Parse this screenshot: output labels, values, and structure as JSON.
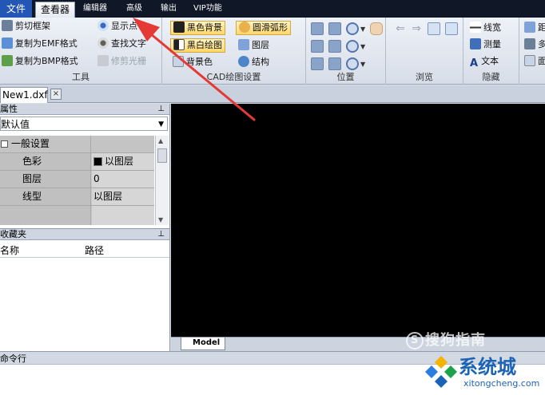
{
  "menubar": {
    "items": [
      "文件",
      "查看器",
      "编辑器",
      "高级",
      "输出",
      "VIP功能"
    ],
    "active": "查看器"
  },
  "ribbon": {
    "tools_group": {
      "label": "工具",
      "buttons": [
        "剪切框架",
        "复制为EMF格式",
        "复制为BMP格式",
        "显示点",
        "查找文字",
        "修剪光栅"
      ]
    },
    "cad_group": {
      "label": "CAD绘图设置",
      "buttons": [
        "黑色背景",
        "圆滑弧形",
        "黑白绘图",
        "图层",
        "背景色",
        "结构"
      ]
    },
    "position_group": {
      "label": "位置"
    },
    "browse_group": {
      "label": "浏览"
    },
    "hide_group": {
      "label": "隐藏",
      "buttons": [
        "线宽",
        "测量",
        "文本"
      ]
    },
    "extra_group": {
      "buttons": [
        "距",
        "多",
        "面"
      ]
    },
    "icons": [
      "cut-icon",
      "emf-icon",
      "bmp-icon",
      "show-point-icon",
      "find-text-icon",
      "crop-raster-icon",
      "zoom-icon",
      "hand-icon",
      "back-arrow-icon",
      "forward-arrow-icon",
      "linewidth-icon",
      "measure-icon"
    ]
  },
  "doc_tab": {
    "name": "New1.dxf",
    "close": "×"
  },
  "properties": {
    "title": "属性",
    "pin": "⊥",
    "combo_value": "默认值",
    "section": "一般设置",
    "rows": [
      {
        "name": "色彩",
        "value": "以图层"
      },
      {
        "name": "图层",
        "value": "0"
      },
      {
        "name": "线型",
        "value": "以图层"
      }
    ]
  },
  "favorites": {
    "title": "收藏夹",
    "pin": "⊥",
    "columns": [
      "名称",
      "路径"
    ]
  },
  "model_tab": "Model",
  "command_line": {
    "title": "命令行"
  },
  "watermark": {
    "sogou": "搜狗指南",
    "site_name": "系统城",
    "site_url": "xitongcheng.com"
  },
  "colors": {
    "canvas": "#000000",
    "menubar": "#101828",
    "file_menu": "#2456b6",
    "highlight": "#ffd86a",
    "annotation_arrow": "#e53935"
  }
}
